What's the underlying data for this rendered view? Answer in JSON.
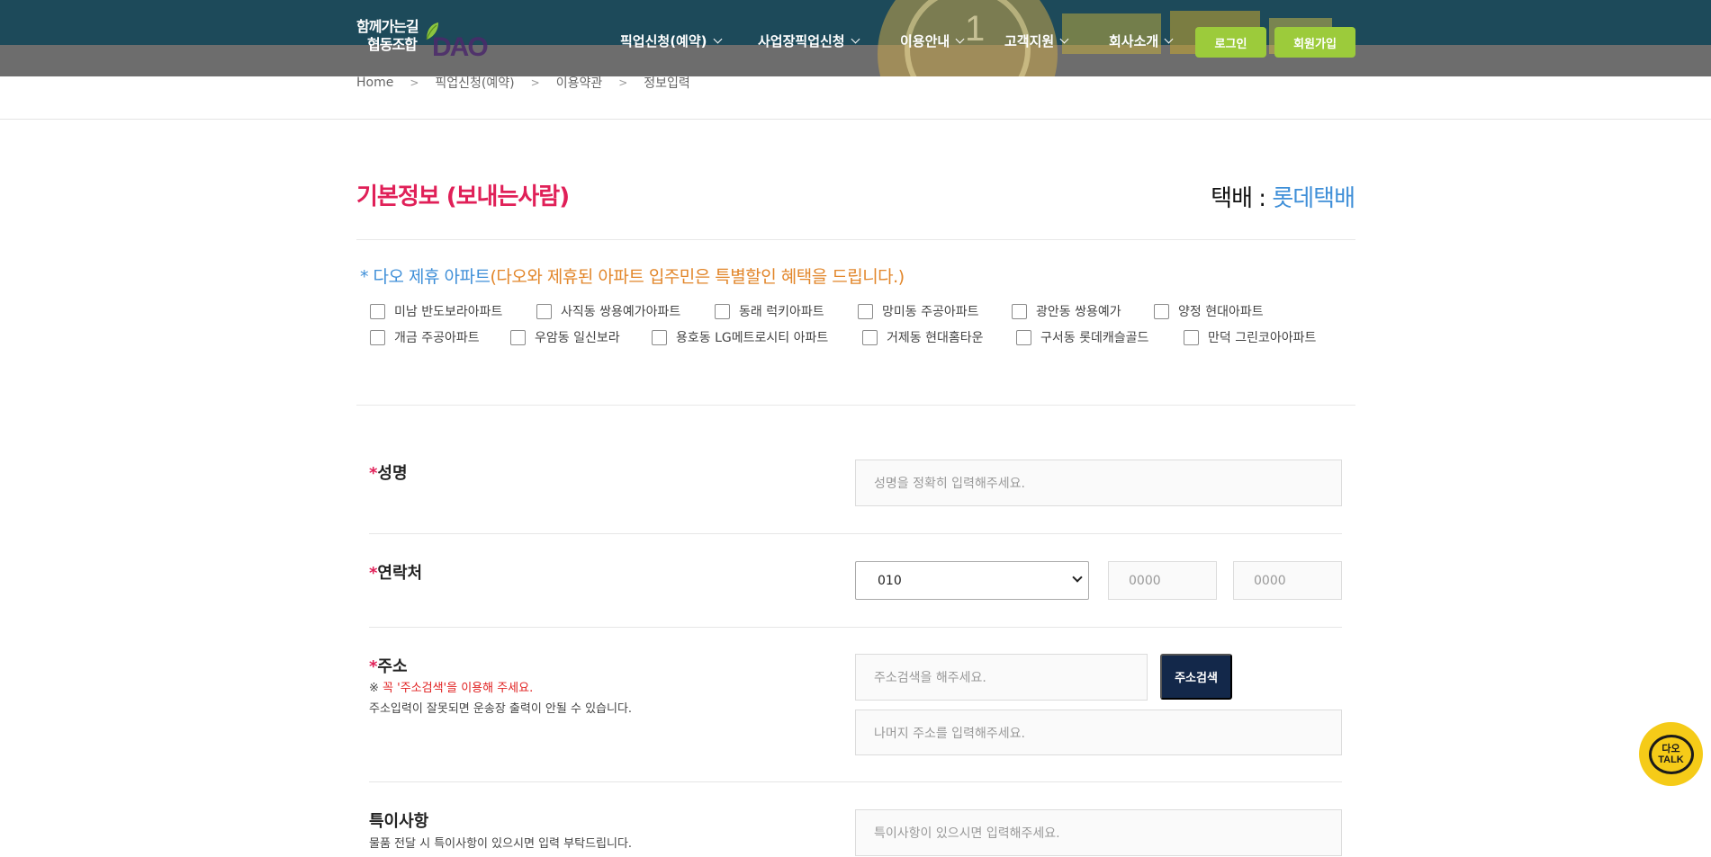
{
  "header": {
    "logo": {
      "line1": "함께가는길",
      "line2": "협동조합",
      "brand": "DAO"
    },
    "nav": [
      {
        "label": "픽업신청(예약)"
      },
      {
        "label": "사업장픽업신청"
      },
      {
        "label": "이용안내"
      },
      {
        "label": "고객지원"
      },
      {
        "label": "회사소개"
      }
    ],
    "login_label": "로그인",
    "join_label": "회원가입",
    "banner_number": "1"
  },
  "breadcrumb": [
    "Home",
    "픽업신청(예약)",
    "이용약관",
    "정보입력"
  ],
  "section": {
    "title": "기본정보 (보내는사람)",
    "courier_label": "택배 : ",
    "courier_value": "롯데택배"
  },
  "apartments": {
    "title_blue": "* 다오 제휴 아파트",
    "title_orange": "(다오와 제휴된 아파트 입주민은 특별할인 혜택을 드립니다.)",
    "row1": [
      "미남 반도보라아파트",
      "사직동 쌍용예가아파트",
      "동래 럭키아파트",
      "망미동 주공아파트",
      "광안동 쌍용예가",
      "양정 현대아파트"
    ],
    "row2": [
      "개금 주공아파트",
      "우암동 일신보라",
      "용호동 LG메트로시티 아파트",
      "거제동 현대홈타운",
      "구서동 롯데캐슬골드",
      "만덕 그린코아아파트"
    ]
  },
  "form": {
    "required_mark": "*",
    "name": {
      "label": "성명",
      "placeholder": "성명을 정확히 입력해주세요."
    },
    "phone": {
      "label": "연락처",
      "prefix": "010",
      "mid_placeholder": "0000",
      "last_placeholder": "0000"
    },
    "address": {
      "label": "주소",
      "note_mark": "※ ",
      "note_red": "꼭 '주소검색'을 이용해 주세요.",
      "note": "주소입력이 잘못되면 운송장 출력이 안될 수 있습니다.",
      "search_placeholder": "주소검색을 해주세요.",
      "search_button": "주소검색",
      "detail_placeholder": "나머지 주소를 입력해주세요."
    },
    "memo": {
      "label": "특이사항",
      "note": "물품 전달 시 특이사항이 있으시면 입력 부탁드립니다.",
      "placeholder": "특이사항이 있으시면 입력해주세요."
    }
  },
  "talk": {
    "line1": "다오",
    "line2": "TALK"
  },
  "colors": {
    "header_bg": "#1d4a5a",
    "accent_green": "#9ccb3b",
    "title_pink": "#e02058",
    "courier_blue": "#3f8fd8",
    "apt_orange": "#e2862a",
    "navy_button": "#13284a",
    "talk_yellow": "#f5cb18"
  },
  "icons": [
    "leaf-icon",
    "chevron-down-icon",
    "breadcrumb-separator-icon",
    "checkbox-icon",
    "talk-bubble-icon"
  ]
}
